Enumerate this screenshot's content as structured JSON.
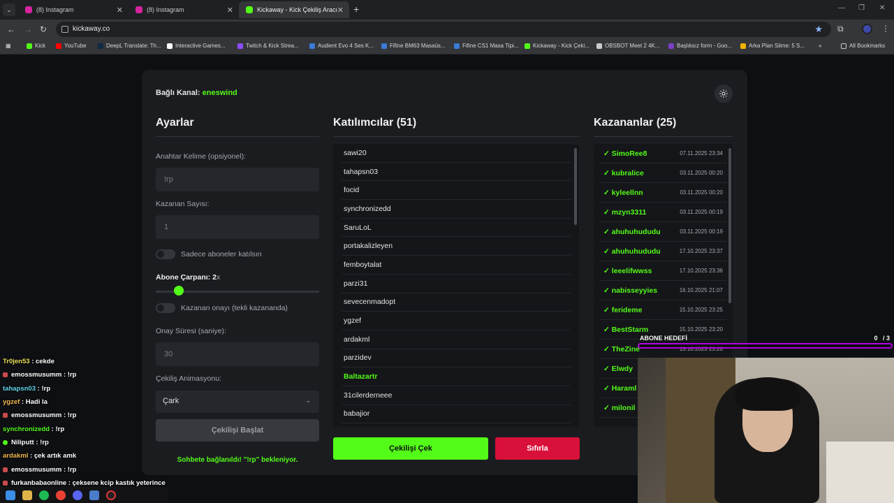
{
  "browser": {
    "tabs": [
      {
        "title": "(8) Instagram",
        "icon": "instagram-icon",
        "active": false
      },
      {
        "title": "(8) Instagram",
        "icon": "instagram-icon",
        "active": false
      },
      {
        "title": "Kickaway - Kick Çekiliş Aracı",
        "icon": "kick-icon",
        "active": true
      }
    ],
    "url": "kickaway.co",
    "bookmarks": [
      {
        "label": "Kick",
        "color": "#53fc18"
      },
      {
        "label": "YouTube",
        "color": "#ff0000"
      },
      {
        "label": "DeepL Translate: Th...",
        "color": "#0f2b46"
      },
      {
        "label": "Interactive Games...",
        "color": "#ffffff"
      },
      {
        "label": "Twitch & Kick Strea...",
        "color": "#8c4cff"
      },
      {
        "label": "Audient Evo 4 Ses K...",
        "color": "#3a7bd5"
      },
      {
        "label": "Fifine BM63 Masaüs...",
        "color": "#3a7bd5"
      },
      {
        "label": "Fifine CS1 Masa Tipi...",
        "color": "#3a7bd5"
      },
      {
        "label": "Kickaway - Kick Çeki...",
        "color": "#53fc18"
      },
      {
        "label": "OBSBOT Meet 2 4K...",
        "color": "#cccccc"
      },
      {
        "label": "Başlıksız form - Goo...",
        "color": "#7b3fc4"
      },
      {
        "label": "Arka Plan Silme: 5 S...",
        "color": "#f2b400"
      }
    ],
    "all_bookmarks": "All Bookmarks"
  },
  "app": {
    "channel_label": "Bağlı Kanal:",
    "channel_name": "eneswind",
    "accent": "#53fc18",
    "danger": "#d8103a",
    "settings": {
      "title": "Ayarlar",
      "keyword_label": "Anahtar Kelime (opsiyonel):",
      "keyword_value": "!rp",
      "winner_count_label": "Kazanan Sayısı:",
      "winner_count_value": "1",
      "subs_only_label": "Sadece aboneler katılsın",
      "multiplier_label": "Abone Çarpanı: 2",
      "multiplier_unit": "x",
      "multiplier_fraction": 0.14,
      "winner_confirm_label": "Kazanan onayı (tekli kazananda)",
      "confirm_time_label": "Onay Süresi (saniye):",
      "confirm_time_value": "30",
      "animation_label": "Çekiliş Animasyonu:",
      "animation_value": "Çark",
      "start_button": "Çekilişi Başlat",
      "status": "Sohbete bağlanıldı! \"!rp\" bekleniyor."
    },
    "participants": {
      "title": "Katılımcılar (51)",
      "items": [
        "sawi20",
        "tahapsn03",
        "focid",
        "synchronizedd",
        "SaruLoL",
        "portakalizleyen",
        "femboytalat",
        "parzi31",
        "sevecenmadopt",
        "ygzef",
        "ardakml",
        "parzidev",
        "Baltazartr",
        "31cilerderneee",
        "babajior"
      ],
      "highlighted": "Baltazartr",
      "draw_button": "Çekilişi Çek",
      "reset_button": "Sıfırla"
    },
    "winners": {
      "title": "Kazananlar (25)",
      "items": [
        {
          "name": "SimoRee8",
          "date": "07.11.2025 23:34"
        },
        {
          "name": "kubralice",
          "date": "03.11.2025 00:20"
        },
        {
          "name": "kyleellnn",
          "date": "03.11.2025 00:20"
        },
        {
          "name": "mzyn3311",
          "date": "03.11.2025 00:19"
        },
        {
          "name": "ahuhuhududu",
          "date": "03.11.2025 00:19"
        },
        {
          "name": "ahuhuhududu",
          "date": "17.10.2025 23:37"
        },
        {
          "name": "leeelifwwss",
          "date": "17.10.2025 23:36"
        },
        {
          "name": "nabisseyyies",
          "date": "16.10.2025 21:07"
        },
        {
          "name": "ferideme",
          "date": "15.10.2025 23:25"
        },
        {
          "name": "BestStarm",
          "date": "15.10.2025 23:20"
        },
        {
          "name": "TheZine",
          "date": "15.10.2025 23:20"
        },
        {
          "name": "Elwdy",
          "date": ""
        },
        {
          "name": "Haraml",
          "date": ""
        },
        {
          "name": "milonil",
          "date": ""
        }
      ]
    }
  },
  "overlay": {
    "chat": [
      {
        "user": "Tr0jen53",
        "msg": "cekde",
        "color": "#e8e05a",
        "badge": ""
      },
      {
        "user": "emossmusumm",
        "msg": "!rp",
        "color": "#ffffff",
        "badge": "sub"
      },
      {
        "user": "tahapsn03",
        "msg": "!rp",
        "color": "#62d3e8",
        "badge": ""
      },
      {
        "user": "ygzef",
        "msg": "Hadi la",
        "color": "#f2b84b",
        "badge": ""
      },
      {
        "user": "emossmusumm",
        "msg": "!rp",
        "color": "#ffffff",
        "badge": "sub"
      },
      {
        "user": "synchronizedd",
        "msg": "!rp",
        "color": "#53fc18",
        "badge": ""
      },
      {
        "user": "Niliputt",
        "msg": "!rp",
        "color": "#ffffff",
        "badge": "green"
      },
      {
        "user": "ardakml",
        "msg": "çek artık amk",
        "color": "#f2b84b",
        "badge": ""
      },
      {
        "user": "emossmusumm",
        "msg": "!rp",
        "color": "#ffffff",
        "badge": "sub"
      },
      {
        "user": "furkanbabaonline",
        "msg": "çeksene kcip kastık yeterince",
        "color": "#ffffff",
        "badge": "sub"
      }
    ],
    "goal_label": "ABONE HEDEFİ",
    "goal_current": "0",
    "goal_total": "/ 3"
  }
}
